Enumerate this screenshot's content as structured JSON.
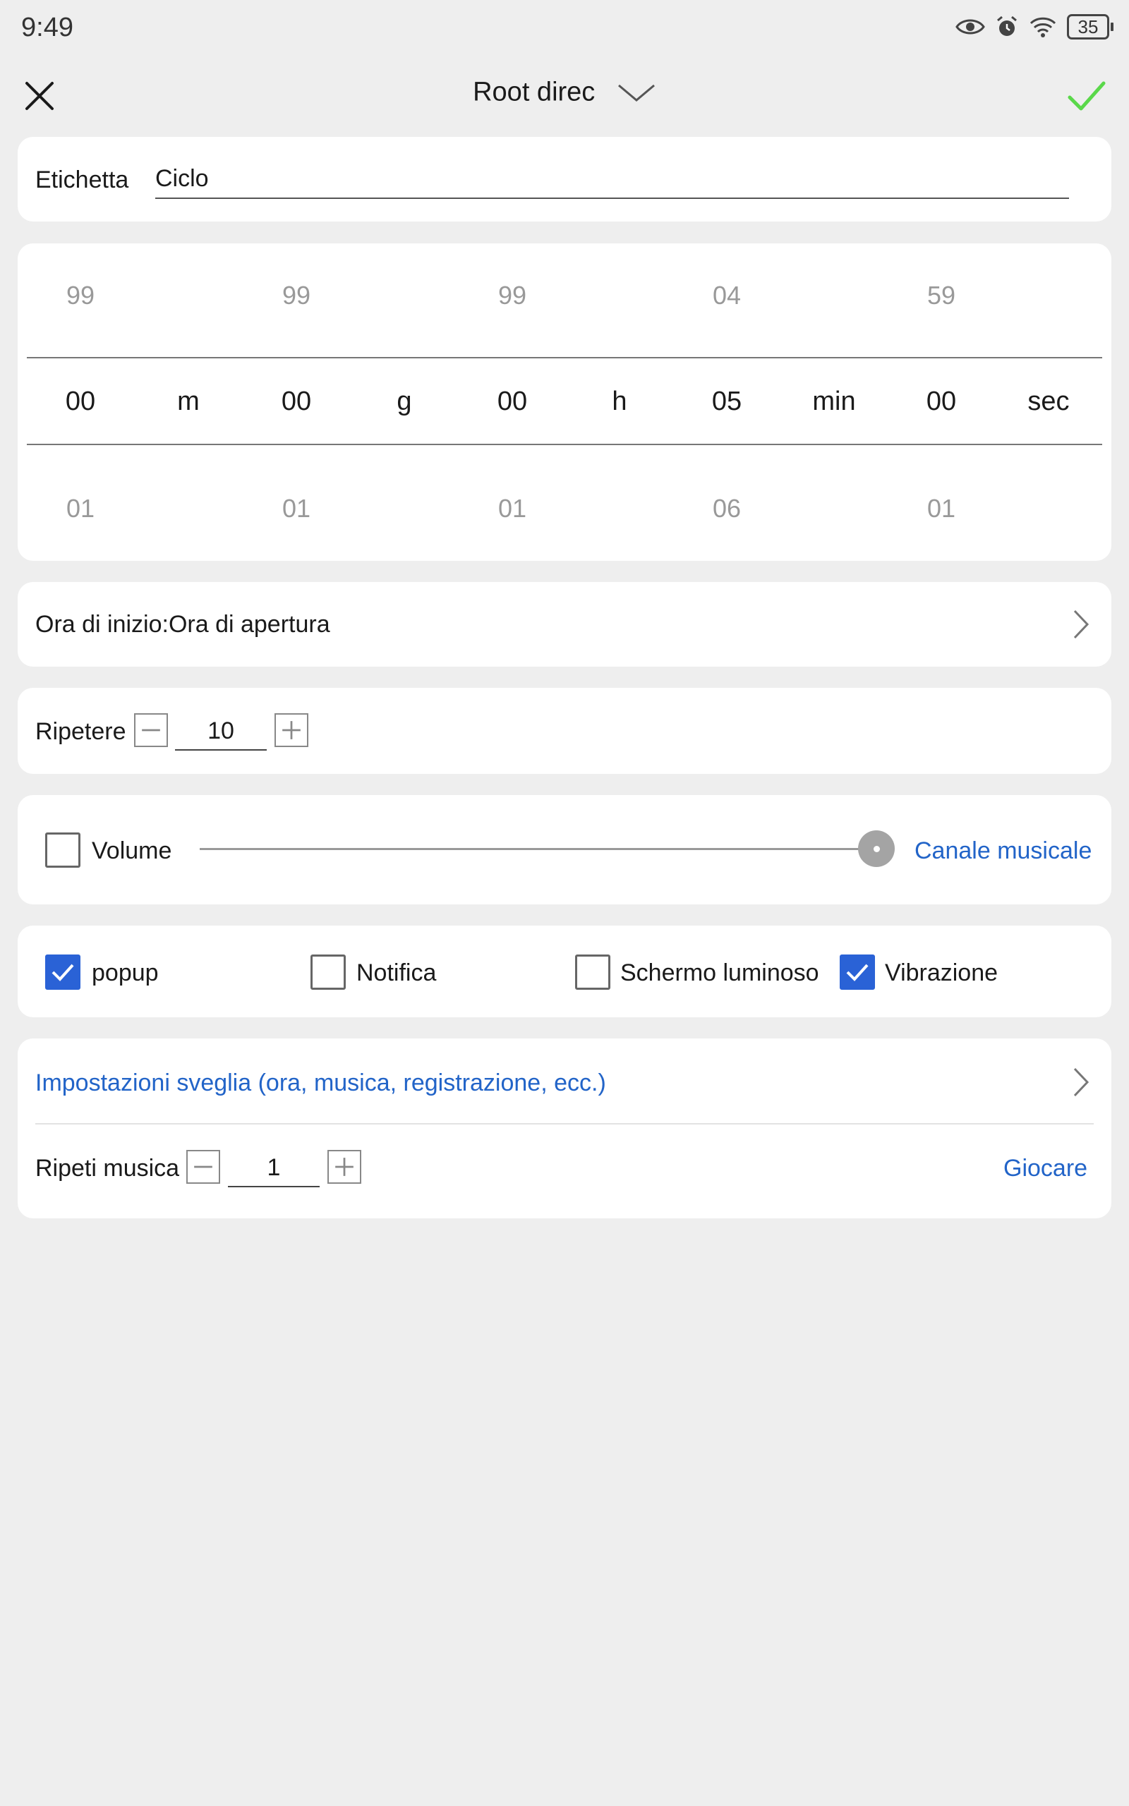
{
  "status_bar": {
    "time": "9:49",
    "battery": "35",
    "icons": [
      "eye-icon",
      "alarm-icon",
      "wifi-icon",
      "battery-icon"
    ]
  },
  "header": {
    "title": "Root direc",
    "close_icon": "close-icon",
    "dropdown_icon": "chevron-down-icon",
    "confirm_icon": "check-icon",
    "confirm_color": "#5ad84a"
  },
  "label_row": {
    "label": "Etichetta",
    "value": "Ciclo"
  },
  "picker": {
    "columns": [
      {
        "above": "99",
        "selected": "00",
        "below": "01",
        "unit": "m"
      },
      {
        "above": "99",
        "selected": "00",
        "below": "01",
        "unit": "g"
      },
      {
        "above": "99",
        "selected": "00",
        "below": "01",
        "unit": "h"
      },
      {
        "above": "04",
        "selected": "05",
        "below": "06",
        "unit": "min"
      },
      {
        "above": "59",
        "selected": "00",
        "below": "01",
        "unit": "sec"
      }
    ]
  },
  "start_time": {
    "text": "Ora di inizio:Ora di apertura"
  },
  "repeat": {
    "label": "Ripetere",
    "value": "10"
  },
  "volume": {
    "label": "Volume",
    "checked": false,
    "level": 1.0,
    "channel_link": "Canale musicale"
  },
  "options": [
    {
      "label": "popup",
      "checked": true
    },
    {
      "label": "Notifica",
      "checked": false
    },
    {
      "label": "Schermo luminoso",
      "checked": false
    },
    {
      "label": "Vibrazione",
      "checked": true
    }
  ],
  "alarm_settings": {
    "link": "Impostazioni sveglia (ora, musica, registrazione, ecc.)"
  },
  "music_repeat": {
    "label": "Ripeti musica",
    "value": "1",
    "play_link": "Giocare"
  },
  "colors": {
    "accent": "#2a62d6",
    "link": "#2264c8",
    "background": "#eeeeee"
  }
}
